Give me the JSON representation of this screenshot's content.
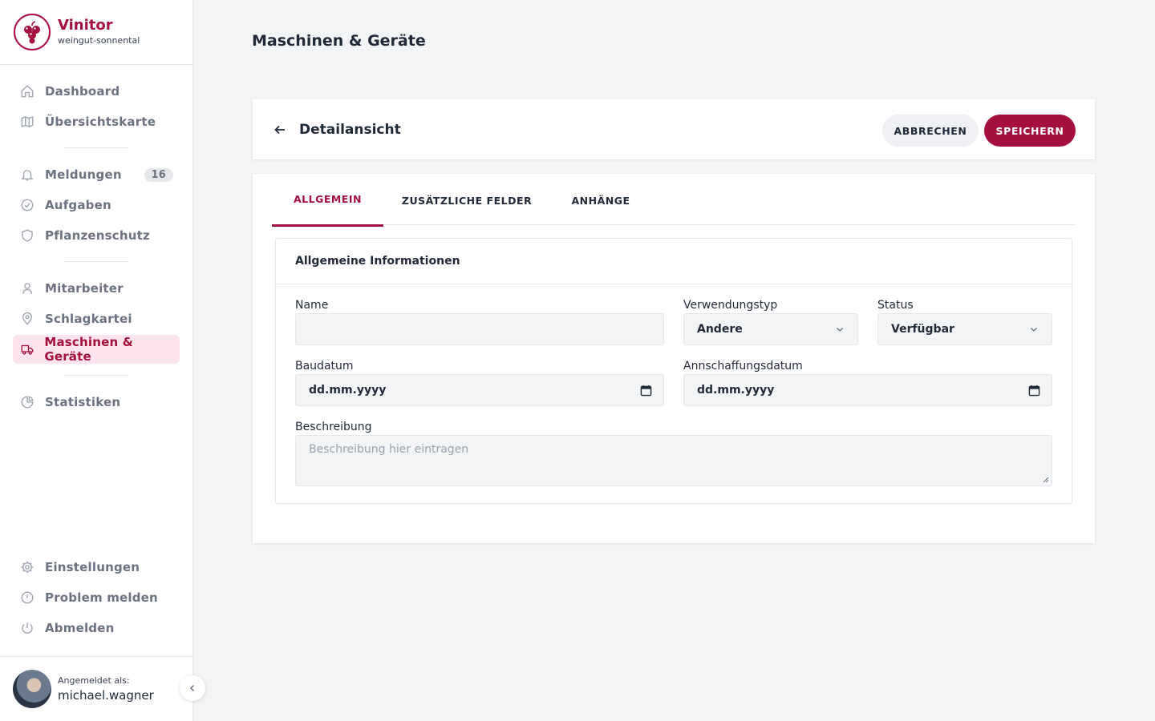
{
  "brand": {
    "name": "Vinitor",
    "subtitle": "weingut-sonnental"
  },
  "nav": {
    "group1": [
      {
        "label": "Dashboard",
        "icon": "home-icon"
      },
      {
        "label": "Übersichtskarte",
        "icon": "map-icon"
      }
    ],
    "group2": [
      {
        "label": "Meldungen",
        "icon": "bell-icon",
        "badge": "16"
      },
      {
        "label": "Aufgaben",
        "icon": "check-circle-icon"
      },
      {
        "label": "Pflanzenschutz",
        "icon": "shield-icon"
      }
    ],
    "group3": [
      {
        "label": "Mitarbeiter",
        "icon": "user-icon"
      },
      {
        "label": "Schlagkartei",
        "icon": "map-pin-icon"
      },
      {
        "label": "Maschinen & Geräte",
        "icon": "truck-icon",
        "active": true
      }
    ],
    "group4": [
      {
        "label": "Statistiken",
        "icon": "pie-chart-icon"
      }
    ],
    "bottom": [
      {
        "label": "Einstellungen",
        "icon": "gear-icon"
      },
      {
        "label": "Problem melden",
        "icon": "alert-circle-icon"
      },
      {
        "label": "Abmelden",
        "icon": "power-icon"
      }
    ]
  },
  "user": {
    "label": "Angemeldet als:",
    "name": "michael.wagner"
  },
  "page": {
    "title": "Maschinen & Geräte"
  },
  "header": {
    "title": "Detailansicht",
    "cancel_label": "ABBRECHEN",
    "save_label": "SPEICHERN"
  },
  "tabs": [
    {
      "label": "ALLGEMEIN",
      "active": true
    },
    {
      "label": "ZUSÄTZLICHE FELDER",
      "active": false
    },
    {
      "label": "ANHÄNGE",
      "active": false
    }
  ],
  "form": {
    "section_title": "Allgemeine Informationen",
    "name": {
      "label": "Name",
      "value": ""
    },
    "verwendungstyp": {
      "label": "Verwendungstyp",
      "value": "Andere"
    },
    "status": {
      "label": "Status",
      "value": "Verfügbar"
    },
    "baudatum": {
      "label": "Baudatum",
      "value": "dd.mm.yyyy"
    },
    "annschaffungsdatum": {
      "label": "Annschaffungsdatum",
      "value": "dd.mm.yyyy"
    },
    "beschreibung": {
      "label": "Beschreibung",
      "placeholder": "Beschreibung hier eintragen"
    }
  },
  "colors": {
    "accent": "#a50f3d",
    "accent_light": "#fbe4ea",
    "background": "#f3f4f6"
  }
}
